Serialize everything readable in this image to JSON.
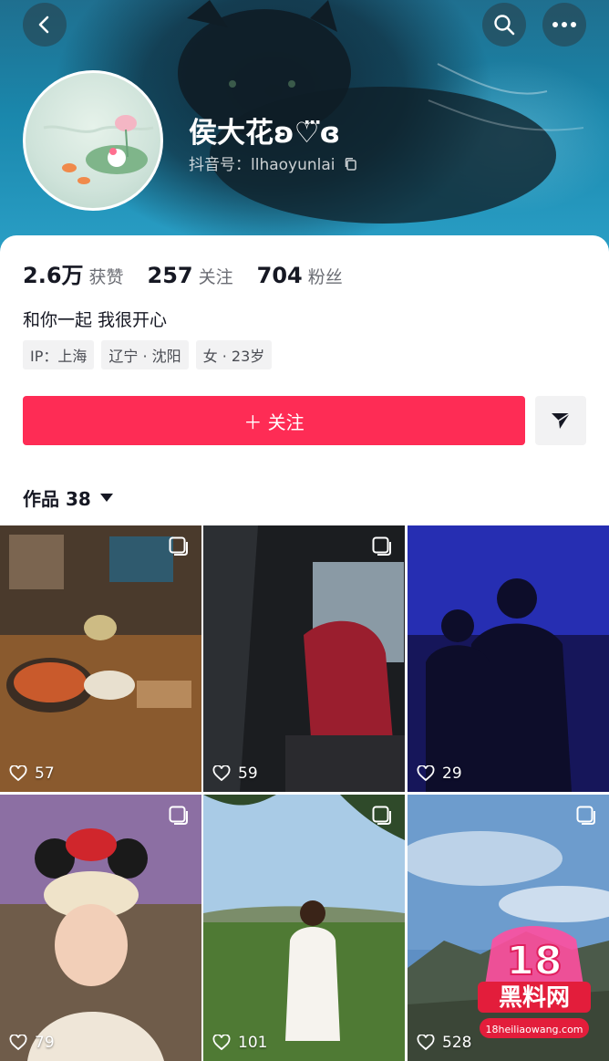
{
  "header": {
    "name": "侯大花ʚ♡⃛ɞ",
    "douyin_id": "抖音号：llhaoyunlai",
    "back_icon": "chevron-left-icon",
    "search_icon": "search-icon",
    "more_icon": "more-dots-icon"
  },
  "stats": {
    "likes_value": "2.6万",
    "likes_label": "获赞",
    "following_value": "257",
    "following_label": "关注",
    "followers_value": "704",
    "followers_label": "粉丝"
  },
  "bio": "和你一起 我很开心",
  "tags": [
    "IP：上海",
    "辽宁 · 沈阳",
    "女 · 23岁"
  ],
  "follow_button": "＋ 关注",
  "share_icon": "send-arrow-icon",
  "works": {
    "label": "作品 38"
  },
  "videos": [
    {
      "likes": "57"
    },
    {
      "likes": "59"
    },
    {
      "likes": "29"
    },
    {
      "likes": "79"
    },
    {
      "likes": "101"
    },
    {
      "likes": "528"
    }
  ],
  "watermark": {
    "big": "18",
    "brand": "黑料网",
    "url": "18heiliaowang.com"
  },
  "colors": {
    "accent": "#fe2c55",
    "text": "#161823",
    "muted": "#6b6d74"
  }
}
